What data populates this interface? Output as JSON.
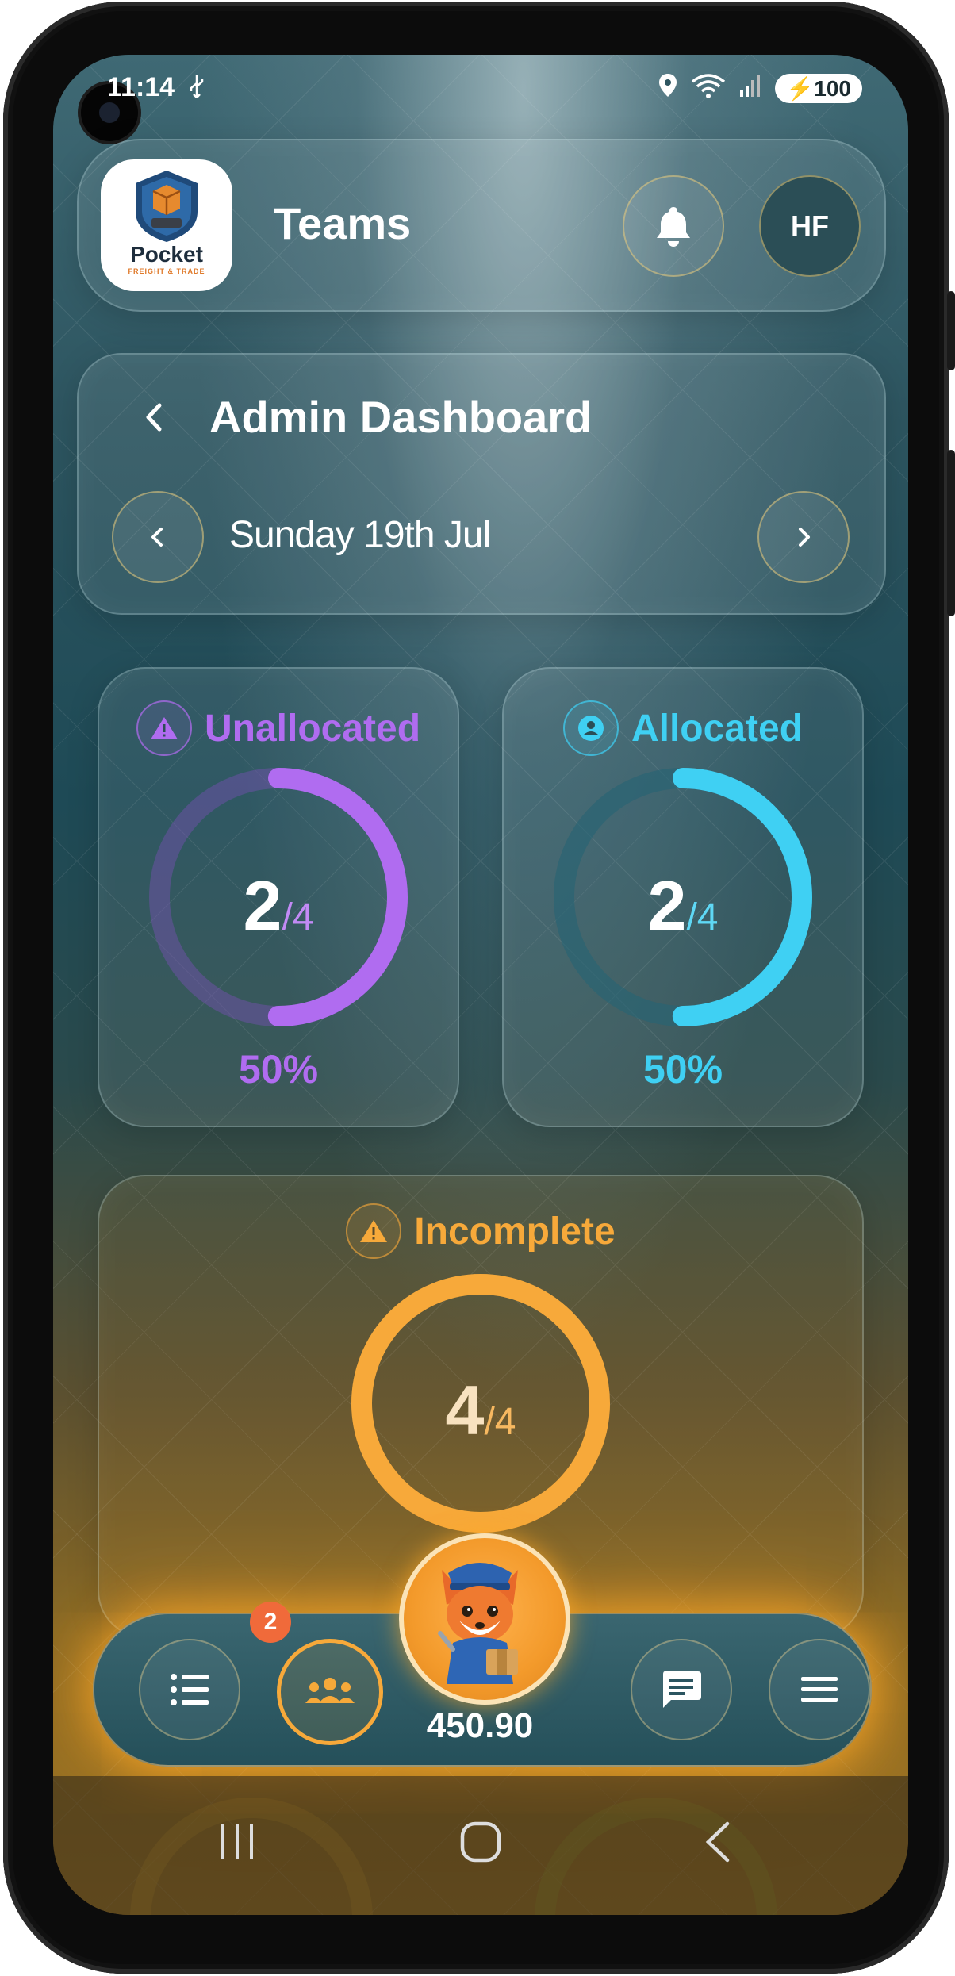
{
  "status_bar": {
    "time": "11:14",
    "battery": "100",
    "icons": [
      "usb-icon",
      "location-icon",
      "wifi-icon",
      "signal-icon",
      "battery-icon"
    ]
  },
  "header": {
    "logo_text": "Pocket",
    "logo_subtext": "FREIGHT & TRADE",
    "title": "Teams",
    "avatar_initials": "HF"
  },
  "dashboard": {
    "title": "Admin Dashboard",
    "date": "Sunday 19th Jul"
  },
  "stats": {
    "unallocated": {
      "label": "Unallocated",
      "count": "2",
      "total": "/4",
      "percent": "50%",
      "fraction": 0.5,
      "color": "#b06cf0"
    },
    "allocated": {
      "label": "Allocated",
      "count": "2",
      "total": "/4",
      "percent": "50%",
      "fraction": 0.5,
      "color": "#3fd0f3"
    },
    "incomplete": {
      "label": "Incomplete",
      "count": "4",
      "total": "/4",
      "fraction": 1.0,
      "color": "#f7a93a"
    }
  },
  "bottom_nav": {
    "list_badge": "2",
    "balance": "450.90",
    "icons": [
      "list-icon",
      "team-icon",
      "chat-icon",
      "menu-icon"
    ]
  },
  "colors": {
    "accent_orange": "#f7a93a",
    "purple": "#b06cf0",
    "cyan": "#3fd0f3",
    "badge_red": "#f06a3a"
  }
}
